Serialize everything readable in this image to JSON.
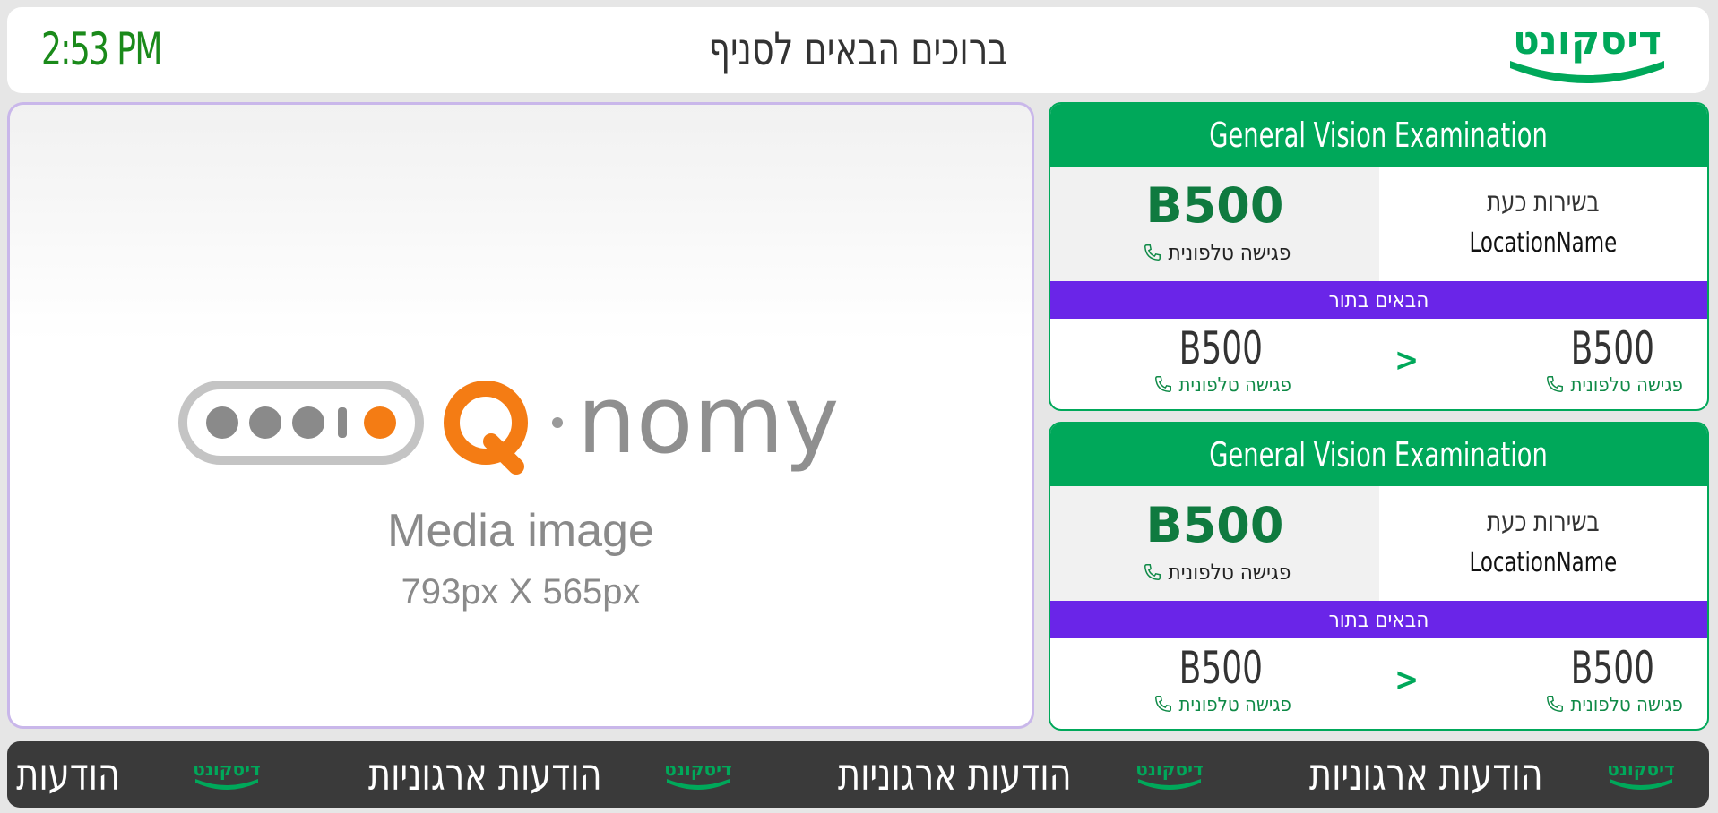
{
  "header": {
    "clock": "2:53 PM",
    "welcome": "ברוכים הבאים לסניף",
    "logo_text": "דיסקונט"
  },
  "media": {
    "brand": "Q·nomy",
    "title": "Media image",
    "size": "793px X 565px"
  },
  "cards": [
    {
      "service": "General Vision Examination",
      "now_label": "בשירות כעת",
      "location": "LocationName",
      "current_ticket": "B500",
      "current_type": "פגישה טלפונית",
      "next_label": "הבאים בתור",
      "next": [
        {
          "ticket": "B500",
          "type": "פגישה טלפונית"
        },
        {
          "ticket": "B500",
          "type": "פגישה טלפונית"
        }
      ],
      "arrow": ">"
    },
    {
      "service": "General Vision Examination",
      "now_label": "בשירות כעת",
      "location": "LocationName",
      "current_ticket": "B500",
      "current_type": "פגישה טלפונית",
      "next_label": "הבאים בתור",
      "next": [
        {
          "ticket": "B500",
          "type": "פגישה טלפונית"
        },
        {
          "ticket": "B500",
          "type": "פגישה טלפונית"
        }
      ],
      "arrow": ">"
    }
  ],
  "ticker": {
    "message": "הודעות ארגוניות",
    "partial": "הודעות"
  },
  "colors": {
    "brand_green": "#00a85a",
    "clock_green": "#1a8a1a",
    "queue_purple": "#6a25e8",
    "ticker_bg": "#3a3a3a",
    "qnomy_orange": "#f47c14"
  }
}
